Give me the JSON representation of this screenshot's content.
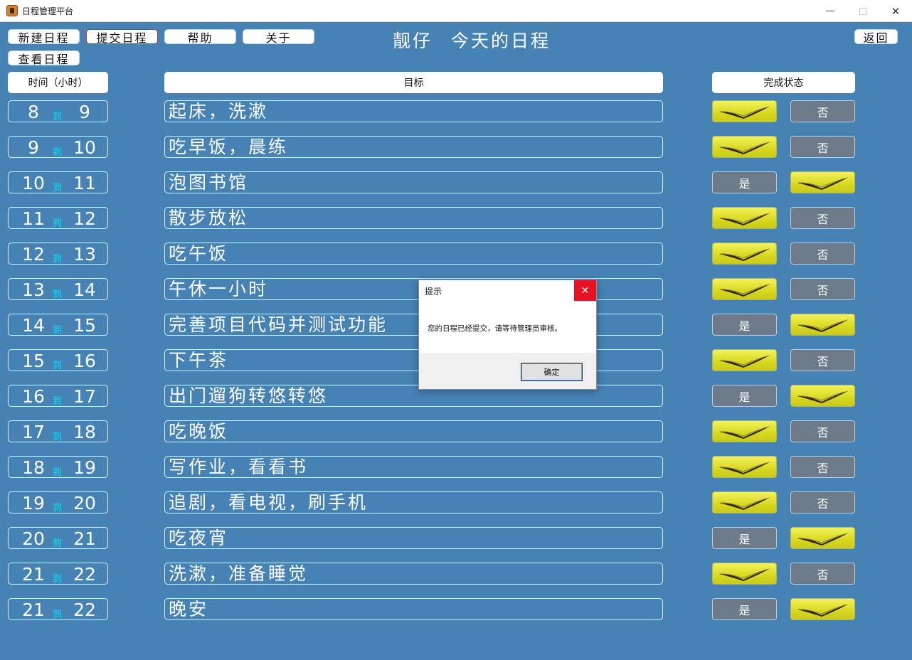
{
  "window": {
    "title": "日程管理平台",
    "minimize_glyph": "—",
    "close_glyph": "✕"
  },
  "toolbar": {
    "new_label": "新建日程",
    "submit_label": "提交日程",
    "help_label": "帮助",
    "about_label": "关于",
    "view_label": "查看日程",
    "back_label": "返回"
  },
  "page_title": {
    "user": "靓仔",
    "subtitle": "今天的日程"
  },
  "columns": {
    "time": "时间（小时）",
    "goal": "目标",
    "status": "完成状态"
  },
  "to_label": "到",
  "yes_label": "是",
  "no_label": "否",
  "rows": [
    {
      "start": "8",
      "end": "9",
      "goal": "起床，洗漱",
      "done": true
    },
    {
      "start": "9",
      "end": "10",
      "goal": "吃早饭，晨练",
      "done": true
    },
    {
      "start": "10",
      "end": "11",
      "goal": "泡图书馆",
      "done": false
    },
    {
      "start": "11",
      "end": "12",
      "goal": "散步放松",
      "done": true
    },
    {
      "start": "12",
      "end": "13",
      "goal": "吃午饭",
      "done": true
    },
    {
      "start": "13",
      "end": "14",
      "goal": "午休一小时",
      "done": true
    },
    {
      "start": "14",
      "end": "15",
      "goal": "完善项目代码并测试功能",
      "done": false
    },
    {
      "start": "15",
      "end": "16",
      "goal": "下午茶",
      "done": true
    },
    {
      "start": "16",
      "end": "17",
      "goal": "出门遛狗转悠转悠",
      "done": false
    },
    {
      "start": "17",
      "end": "18",
      "goal": "吃晚饭",
      "done": true
    },
    {
      "start": "18",
      "end": "19",
      "goal": "写作业，看看书",
      "done": true
    },
    {
      "start": "19",
      "end": "20",
      "goal": "追剧，看电视，刷手机",
      "done": true
    },
    {
      "start": "20",
      "end": "21",
      "goal": "吃夜宵",
      "done": false
    },
    {
      "start": "21",
      "end": "22",
      "goal": "洗漱，准备睡觉",
      "done": true
    },
    {
      "start": "21",
      "end": "22",
      "goal": "晚安",
      "done": false
    }
  ],
  "dialog": {
    "title": "提示",
    "close_glyph": "✕",
    "message": "您的日程已经提交，请等待管理员审核。",
    "ok_label": "确定"
  },
  "colors": {
    "background": "#4682b4",
    "checked": "#e6e632",
    "plain_button": "#6c7a89",
    "to_text": "#00e5ff",
    "close_red": "#e81123"
  }
}
